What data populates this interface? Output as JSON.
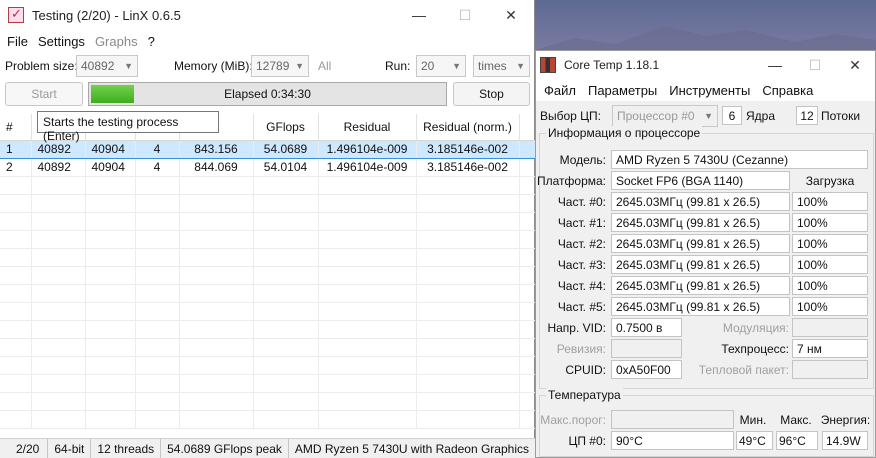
{
  "linx": {
    "title": "Testing (2/20) - LinX 0.6.5",
    "window_controls": {
      "minimize": "—",
      "maximize": "☐",
      "close": "✕"
    },
    "menu": [
      "File",
      "Settings",
      "Graphs",
      "?"
    ],
    "params": {
      "problem_size_label": "Problem size:",
      "problem_size_value": "40892",
      "memory_label": "Memory (MiB):",
      "memory_value": "12789",
      "memory_all": "All",
      "run_label": "Run:",
      "run_value": "20",
      "run_unit": "times"
    },
    "start_label": "Start",
    "stop_label": "Stop",
    "progress_fraction": 0.12,
    "elapsed": "Elapsed 0:34:30",
    "tooltip": "Starts the testing process (Enter)",
    "columns": [
      "#",
      "",
      "",
      "",
      "GFlops",
      "Residual",
      "Residual (norm.)"
    ],
    "rows": [
      [
        "1",
        "40892",
        "40904",
        "4",
        "843.156",
        "54.0689",
        "1.496104e-009",
        "3.185146e-002"
      ],
      [
        "2",
        "40892",
        "40904",
        "4",
        "844.069",
        "54.0104",
        "1.496104e-009",
        "3.185146e-002"
      ]
    ],
    "status": {
      "progress": "2/20",
      "bits": "64-bit",
      "threads": "12 threads",
      "peak": "54.0689 GFlops peak",
      "cpu": "AMD Ryzen 5 7430U with Radeon Graphics"
    }
  },
  "coretemp": {
    "title": "Core Temp 1.18.1",
    "menu": [
      "Файл",
      "Параметры",
      "Инструменты",
      "Справка"
    ],
    "cpu_select_label": "Выбор ЦП:",
    "cpu_select_value": "Процессор #0",
    "cores_count": "6",
    "cores_label": "Ядра",
    "threads_count": "12",
    "threads_label": "Потоки",
    "info_group_title": "Информация о процессоре",
    "model_label": "Модель:",
    "model_value": "AMD Ryzen 5 7430U (Cezanne)",
    "platform_label": "Платформа:",
    "platform_value": "Socket FP6 (BGA 1140)",
    "load_header": "Загрузка",
    "cores": [
      {
        "label": "Част. #0:",
        "freq": "2645.03МГц (99.81 x 26.5)",
        "load": "100%"
      },
      {
        "label": "Част. #1:",
        "freq": "2645.03МГц (99.81 x 26.5)",
        "load": "100%"
      },
      {
        "label": "Част. #2:",
        "freq": "2645.03МГц (99.81 x 26.5)",
        "load": "100%"
      },
      {
        "label": "Част. #3:",
        "freq": "2645.03МГц (99.81 x 26.5)",
        "load": "100%"
      },
      {
        "label": "Част. #4:",
        "freq": "2645.03МГц (99.81 x 26.5)",
        "load": "100%"
      },
      {
        "label": "Част. #5:",
        "freq": "2645.03МГц (99.81 x 26.5)",
        "load": "100%"
      }
    ],
    "vid_label": "Напр. VID:",
    "vid_value": "0.7500 в",
    "modulation_label": "Модуляция:",
    "revision_label": "Ревизия:",
    "process_label": "Техпроцесс:",
    "process_value": "7 нм",
    "cpuid_label": "CPUID:",
    "cpuid_value": "0xA50F00",
    "tdp_label": "Тепловой пакет:",
    "temp_group_title": "Температура",
    "tjmax_label": "Макс.порог:",
    "min_header": "Мин.",
    "max_header": "Макс.",
    "power_header": "Энергия:",
    "cpu0_label": "ЦП #0:",
    "cpu0_temp": "90°C",
    "cpu0_min": "49°C",
    "cpu0_max": "96°C",
    "cpu0_power": "14.9W"
  }
}
